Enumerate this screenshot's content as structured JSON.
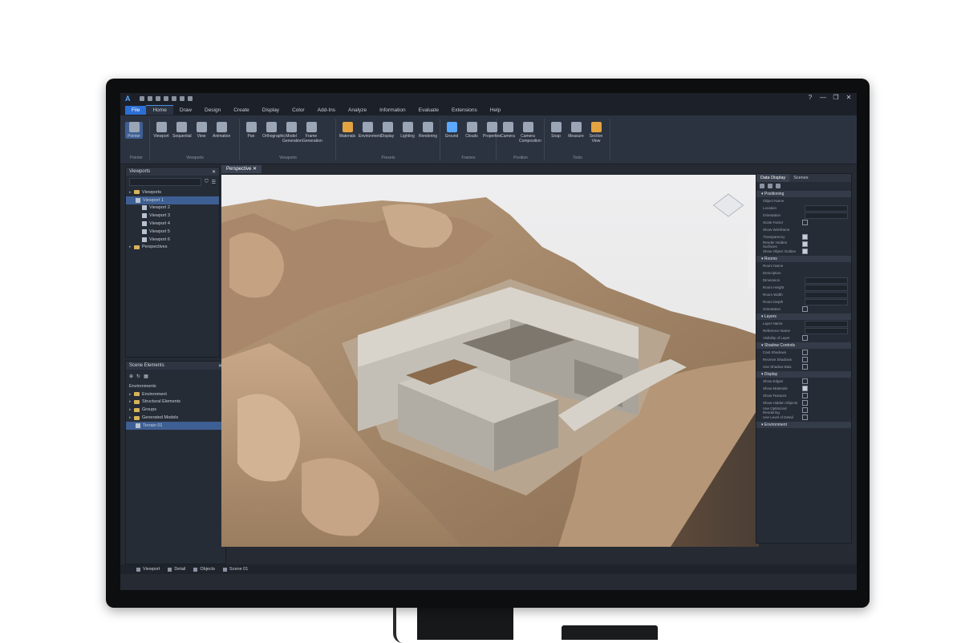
{
  "app": {
    "logo": "A",
    "window_controls": [
      "?",
      "—",
      "❐",
      "✕"
    ]
  },
  "menu": {
    "tabs": [
      "File",
      "Home",
      "Draw",
      "Design",
      "Create",
      "Display",
      "Color",
      "Add-Ins",
      "Analyze",
      "Information",
      "Evaluate",
      "Extensions",
      "Help"
    ]
  },
  "ribbon": {
    "groups": [
      {
        "label": "Pointer",
        "buttons": [
          "Pointer"
        ]
      },
      {
        "label": "Viewports",
        "buttons": [
          "Viewport",
          "Sequential",
          "View",
          "Animation"
        ]
      },
      {
        "label": "Viewports",
        "buttons": [
          "Pan",
          "Orthographic",
          "Model Generation",
          "Frame Generation"
        ]
      },
      {
        "label": "Presets",
        "buttons": [
          "Materials",
          "Environment",
          "Display",
          "Lighting",
          "Rendering"
        ]
      },
      {
        "label": "Frames",
        "buttons": [
          "Ground",
          "Clouds",
          "Properties"
        ]
      },
      {
        "label": "Position",
        "buttons": [
          "Camera",
          "Camera Composition"
        ]
      },
      {
        "label": "Tools",
        "buttons": [
          "Snap",
          "Measure",
          "Section View"
        ]
      }
    ]
  },
  "viewports_panel": {
    "title": "Viewports",
    "items": [
      {
        "label": "Viewports",
        "type": "folder",
        "level": 0
      },
      {
        "label": "Viewport 1",
        "type": "view",
        "level": 1,
        "selected": true
      },
      {
        "label": "Viewport 2",
        "type": "view",
        "level": 2
      },
      {
        "label": "Viewport 3",
        "type": "view",
        "level": 2
      },
      {
        "label": "Viewport 4",
        "type": "view",
        "level": 2
      },
      {
        "label": "Viewport 5",
        "type": "view",
        "level": 2
      },
      {
        "label": "Viewport 6",
        "type": "view",
        "level": 2
      },
      {
        "label": "Perspectives",
        "type": "folder",
        "level": 0
      }
    ]
  },
  "scene_panel": {
    "title": "Scene Elements",
    "items": [
      {
        "label": "Environments",
        "type": "header",
        "level": 0
      },
      {
        "label": "Environment",
        "type": "folder",
        "level": 0
      },
      {
        "label": "Structural Elements",
        "type": "folder",
        "level": 0
      },
      {
        "label": "Groups",
        "type": "folder",
        "level": 0
      },
      {
        "label": "Generated Models",
        "type": "folder",
        "level": 0
      },
      {
        "label": "Terrain 01",
        "type": "view",
        "level": 1,
        "selected": true
      }
    ]
  },
  "viewport": {
    "tab_label": "Perspective"
  },
  "properties_panel": {
    "tabs": [
      "Data Display",
      "Scenes"
    ],
    "sections": [
      {
        "title": "Positioning",
        "props": [
          {
            "label": "Object Name",
            "kind": "none"
          },
          {
            "label": "Location",
            "kind": "field"
          },
          {
            "label": "Orientation",
            "kind": "field"
          },
          {
            "label": "Scale Factor",
            "kind": "check",
            "on": false
          },
          {
            "label": "Show Wireframe",
            "kind": "none"
          },
          {
            "label": "Transparency",
            "kind": "check",
            "on": true
          },
          {
            "label": "Render Hidden Surfaces",
            "kind": "check",
            "on": true
          },
          {
            "label": "Show Object Outline",
            "kind": "check",
            "on": true
          }
        ]
      },
      {
        "title": "Rooms",
        "props": [
          {
            "label": "Room Name",
            "kind": "none"
          },
          {
            "label": "Description",
            "kind": "none"
          },
          {
            "label": "Dimension",
            "kind": "field"
          },
          {
            "label": "Room Height",
            "kind": "field"
          },
          {
            "label": "Room Width",
            "kind": "field"
          },
          {
            "label": "Room Depth",
            "kind": "field"
          },
          {
            "label": "Orientation",
            "kind": "check",
            "on": false
          }
        ]
      },
      {
        "title": "Layers",
        "props": [
          {
            "label": "Layer Name",
            "kind": "field"
          },
          {
            "label": "Reference Name",
            "kind": "field"
          },
          {
            "label": "Visibility of Layer",
            "kind": "check",
            "on": false
          }
        ]
      },
      {
        "title": "Shadow Controls",
        "props": [
          {
            "label": "Cast Shadows",
            "kind": "check",
            "on": false
          },
          {
            "label": "Receive Shadows",
            "kind": "check",
            "on": false
          },
          {
            "label": "Use Shadow Bias",
            "kind": "check",
            "on": false
          }
        ]
      },
      {
        "title": "Display",
        "props": [
          {
            "label": "Show Edges",
            "kind": "check",
            "on": false
          },
          {
            "label": "Show Materials",
            "kind": "check",
            "on": true
          },
          {
            "label": "Show Textures",
            "kind": "check",
            "on": false
          },
          {
            "label": "Show Hidden Objects",
            "kind": "check",
            "on": false
          },
          {
            "label": "Use Optimized Rendering",
            "kind": "check",
            "on": false
          },
          {
            "label": "Use Level of Detail",
            "kind": "check",
            "on": false
          }
        ]
      },
      {
        "title": "Environment",
        "props": []
      }
    ]
  },
  "statusbar": {
    "items": [
      "Viewport",
      "Detail",
      "Objects",
      "Scene 01"
    ]
  },
  "colors": {
    "accent": "#2c6fd6",
    "selection": "#3e5f93",
    "panel_bg": "#262c36"
  }
}
